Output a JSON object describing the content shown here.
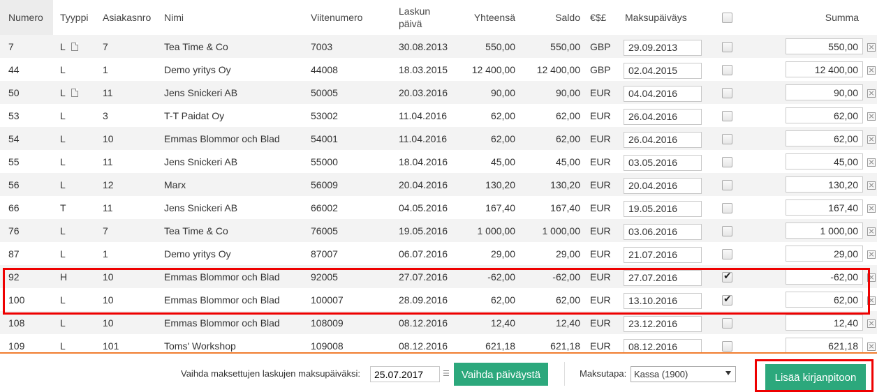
{
  "columns": {
    "numero": "Numero",
    "tyyppi": "Tyyppi",
    "asiakasnro": "Asiakasnro",
    "nimi": "Nimi",
    "viitenumero": "Viitenumero",
    "laskun_paiva_1": "Laskun",
    "laskun_paiva_2": "päivä",
    "yhteensa": "Yhteensä",
    "saldo": "Saldo",
    "valuutta": "€$£",
    "maksupaivays": "Maksupäiväys",
    "summa": "Summa"
  },
  "rows": [
    {
      "numero": "7",
      "tyyppi": "L",
      "doc": true,
      "asiakasnro": "7",
      "nimi": "Tea Time & Co",
      "viite": "7003",
      "pvm": "30.08.2013",
      "yhteensa": "550,00",
      "saldo": "550,00",
      "valuutta": "GBP",
      "maksupaiva": "29.09.2013",
      "checked": false,
      "summa": "550,00"
    },
    {
      "numero": "44",
      "tyyppi": "L",
      "doc": false,
      "asiakasnro": "1",
      "nimi": "Demo yritys Oy",
      "viite": "44008",
      "pvm": "18.03.2015",
      "yhteensa": "12 400,00",
      "saldo": "12 400,00",
      "valuutta": "GBP",
      "maksupaiva": "02.04.2015",
      "checked": false,
      "summa": "12 400,00"
    },
    {
      "numero": "50",
      "tyyppi": "L",
      "doc": true,
      "asiakasnro": "11",
      "nimi": "Jens Snickeri AB",
      "viite": "50005",
      "pvm": "20.03.2016",
      "yhteensa": "90,00",
      "saldo": "90,00",
      "valuutta": "EUR",
      "maksupaiva": "04.04.2016",
      "checked": false,
      "summa": "90,00"
    },
    {
      "numero": "53",
      "tyyppi": "L",
      "doc": false,
      "asiakasnro": "3",
      "nimi": "T-T Paidat Oy",
      "viite": "53002",
      "pvm": "11.04.2016",
      "yhteensa": "62,00",
      "saldo": "62,00",
      "valuutta": "EUR",
      "maksupaiva": "26.04.2016",
      "checked": false,
      "summa": "62,00"
    },
    {
      "numero": "54",
      "tyyppi": "L",
      "doc": false,
      "asiakasnro": "10",
      "nimi": "Emmas Blommor och Blad",
      "viite": "54001",
      "pvm": "11.04.2016",
      "yhteensa": "62,00",
      "saldo": "62,00",
      "valuutta": "EUR",
      "maksupaiva": "26.04.2016",
      "checked": false,
      "summa": "62,00"
    },
    {
      "numero": "55",
      "tyyppi": "L",
      "doc": false,
      "asiakasnro": "11",
      "nimi": "Jens Snickeri AB",
      "viite": "55000",
      "pvm": "18.04.2016",
      "yhteensa": "45,00",
      "saldo": "45,00",
      "valuutta": "EUR",
      "maksupaiva": "03.05.2016",
      "checked": false,
      "summa": "45,00"
    },
    {
      "numero": "56",
      "tyyppi": "L",
      "doc": false,
      "asiakasnro": "12",
      "nimi": "Marx",
      "viite": "56009",
      "pvm": "20.04.2016",
      "yhteensa": "130,20",
      "saldo": "130,20",
      "valuutta": "EUR",
      "maksupaiva": "20.04.2016",
      "checked": false,
      "summa": "130,20"
    },
    {
      "numero": "66",
      "tyyppi": "T",
      "doc": false,
      "asiakasnro": "11",
      "nimi": "Jens Snickeri AB",
      "viite": "66002",
      "pvm": "04.05.2016",
      "yhteensa": "167,40",
      "saldo": "167,40",
      "valuutta": "EUR",
      "maksupaiva": "19.05.2016",
      "checked": false,
      "summa": "167,40"
    },
    {
      "numero": "76",
      "tyyppi": "L",
      "doc": false,
      "asiakasnro": "7",
      "nimi": "Tea Time & Co",
      "viite": "76005",
      "pvm": "19.05.2016",
      "yhteensa": "1 000,00",
      "saldo": "1 000,00",
      "valuutta": "EUR",
      "maksupaiva": "03.06.2016",
      "checked": false,
      "summa": "1 000,00"
    },
    {
      "numero": "87",
      "tyyppi": "L",
      "doc": false,
      "asiakasnro": "1",
      "nimi": "Demo yritys Oy",
      "viite": "87007",
      "pvm": "06.07.2016",
      "yhteensa": "29,00",
      "saldo": "29,00",
      "valuutta": "EUR",
      "maksupaiva": "21.07.2016",
      "checked": false,
      "summa": "29,00"
    },
    {
      "numero": "92",
      "tyyppi": "H",
      "doc": false,
      "asiakasnro": "10",
      "nimi": "Emmas Blommor och Blad",
      "viite": "92005",
      "pvm": "27.07.2016",
      "yhteensa": "-62,00",
      "saldo": "-62,00",
      "valuutta": "EUR",
      "maksupaiva": "27.07.2016",
      "checked": true,
      "summa": "-62,00"
    },
    {
      "numero": "100",
      "tyyppi": "L",
      "doc": false,
      "asiakasnro": "10",
      "nimi": "Emmas Blommor och Blad",
      "viite": "100007",
      "pvm": "28.09.2016",
      "yhteensa": "62,00",
      "saldo": "62,00",
      "valuutta": "EUR",
      "maksupaiva": "13.10.2016",
      "checked": true,
      "summa": "62,00"
    },
    {
      "numero": "108",
      "tyyppi": "L",
      "doc": false,
      "asiakasnro": "10",
      "nimi": "Emmas Blommor och Blad",
      "viite": "108009",
      "pvm": "08.12.2016",
      "yhteensa": "12,40",
      "saldo": "12,40",
      "valuutta": "EUR",
      "maksupaiva": "23.12.2016",
      "checked": false,
      "summa": "12,40"
    },
    {
      "numero": "109",
      "tyyppi": "L",
      "doc": false,
      "asiakasnro": "101",
      "nimi": "Toms' Workshop",
      "viite": "109008",
      "pvm": "08.12.2016",
      "yhteensa": "621,18",
      "saldo": "621,18",
      "valuutta": "EUR",
      "maksupaiva": "08.12.2016",
      "checked": false,
      "summa": "621,18"
    }
  ],
  "footer": {
    "change_date_label": "Vaihda maksettujen laskujen maksupäiväksi:",
    "change_date_value": "25.07.2017",
    "change_date_button": "Vaihda päiväystä",
    "payment_method_label": "Maksutapa:",
    "payment_method_value": "Kassa (1900)",
    "add_button": "Lisää kirjanpitoon"
  },
  "icons": {
    "document": "document-icon",
    "remove": "remove-icon",
    "calendar": "calendar-icon"
  },
  "colors": {
    "accent_button": "#2ca87c",
    "highlight": "#ee0000",
    "footer_line": "#f07d2f"
  }
}
